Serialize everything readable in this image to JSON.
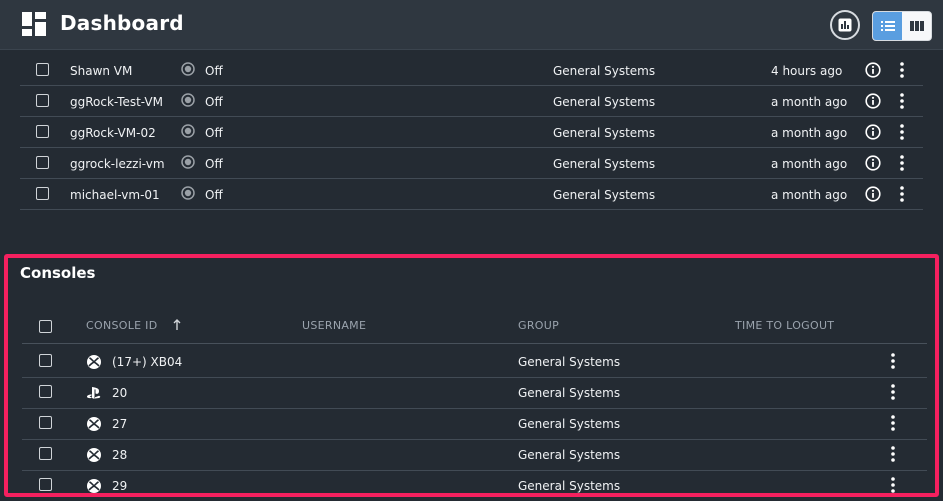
{
  "header": {
    "title": "Dashboard"
  },
  "vms": [
    {
      "name": "Shawn VM",
      "status": "Off",
      "group": "General Systems",
      "last_active": "4 hours ago"
    },
    {
      "name": "ggRock-Test-VM",
      "status": "Off",
      "group": "General Systems",
      "last_active": "a month ago"
    },
    {
      "name": "ggRock-VM-02",
      "status": "Off",
      "group": "General Systems",
      "last_active": "a month ago"
    },
    {
      "name": "ggrock-lezzi-vm",
      "status": "Off",
      "group": "General Systems",
      "last_active": "a month ago"
    },
    {
      "name": "michael-vm-01",
      "status": "Off",
      "group": "General Systems",
      "last_active": "a month ago"
    }
  ],
  "consoles": {
    "heading": "Consoles",
    "columns": {
      "console_id": "CONSOLE ID",
      "username": "USERNAME",
      "group": "GROUP",
      "time_to_logout": "TIME TO LOGOUT"
    },
    "rows": [
      {
        "platform": "xbox-icon",
        "console_id": "(17+) XB04",
        "username": "",
        "group": "General Systems",
        "time_to_logout": ""
      },
      {
        "platform": "playstation-icon",
        "console_id": "20",
        "username": "",
        "group": "General Systems",
        "time_to_logout": ""
      },
      {
        "platform": "xbox-icon",
        "console_id": "27",
        "username": "",
        "group": "General Systems",
        "time_to_logout": ""
      },
      {
        "platform": "xbox-icon",
        "console_id": "28",
        "username": "",
        "group": "General Systems",
        "time_to_logout": ""
      },
      {
        "platform": "xbox-icon",
        "console_id": "29",
        "username": "",
        "group": "General Systems",
        "time_to_logout": ""
      }
    ]
  },
  "colors": {
    "background": "#242b33",
    "topbar": "#2f3740",
    "highlight_border": "#f5205f",
    "toggle_active": "#5a9ee0"
  }
}
